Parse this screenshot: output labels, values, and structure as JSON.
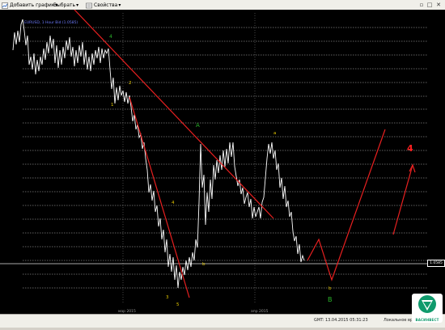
{
  "toolbar": {
    "add_chart_label": "Добавить график",
    "select_label": "Выбрать",
    "properties_label": "Свойства"
  },
  "chart": {
    "instrument_title": "EURUSD, 1 Hour Bid (1.0585)",
    "current_price": "1.0585",
    "date_labels": [
      "мар 2015",
      "апр 2015"
    ],
    "wave_labels": {
      "w1": "1",
      "w2": "2",
      "w3": "3",
      "w4_top": "4",
      "w4_low": "4",
      "w5": "5",
      "wA": "A",
      "wA_small": "a",
      "wB": "B",
      "wb_small": "b",
      "w4_big": "4"
    },
    "colors": {
      "background": "#000000",
      "price_line": "#ffffff",
      "trend_line": "#e82020",
      "grid": "#c8c8c8",
      "wave_green": "#2bb52b",
      "wave_yellow": "#e6c800",
      "wave_red": "#ff2020"
    }
  },
  "statusbar": {
    "gmt_label": "GMT: 13.04.2015 05:31:23",
    "local_label": "Локальное вр",
    "value": "1.0585"
  },
  "logo": {
    "brand": "ВАСИНВЕСТ"
  }
}
